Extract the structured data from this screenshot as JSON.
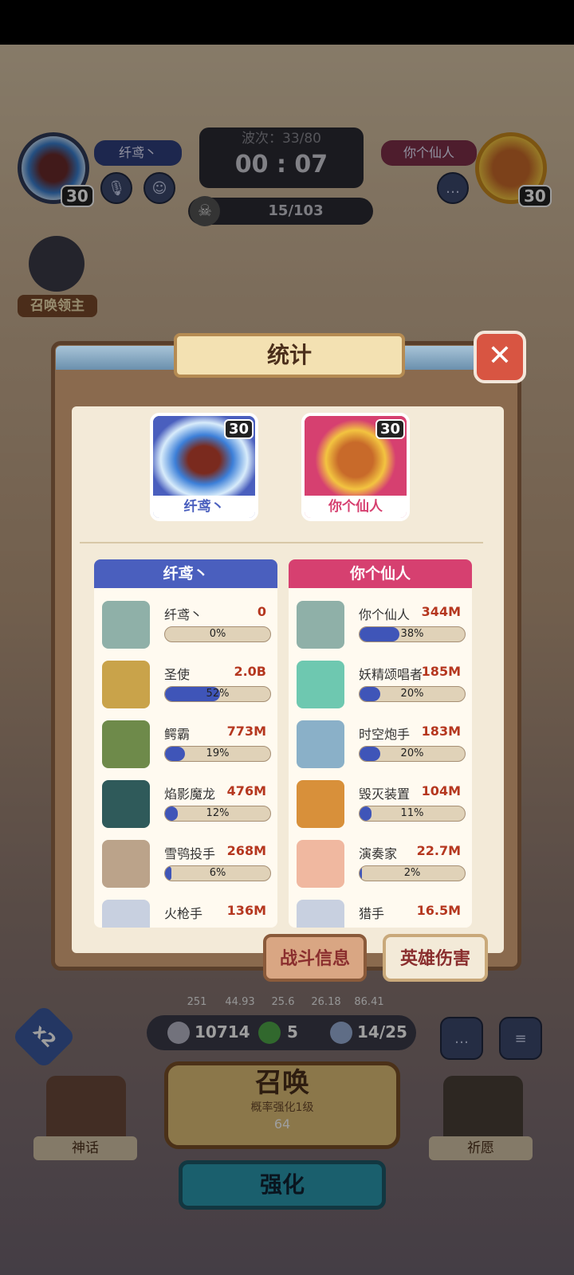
{
  "hud": {
    "left_player_name": "纤鸢丶",
    "left_level": "30",
    "right_player_name": "你个仙人",
    "right_level": "30",
    "wave_label": "波次：33/80",
    "timer": "00 : 07",
    "kill_counter": "15/103",
    "summon_lord_label": "召唤领主"
  },
  "modal": {
    "title": "统计",
    "close_icon": "close-icon",
    "player_cards": [
      {
        "name": "纤鸢丶",
        "level": "30",
        "color": "#4a5fbe"
      },
      {
        "name": "你个仙人",
        "level": "30",
        "color": "#d64070"
      }
    ],
    "left_column": {
      "header": "纤鸢丶",
      "color": "#4a5fbe",
      "rows": [
        {
          "name": "纤鸢丶",
          "value": "0",
          "percent": "0%",
          "fill": 0
        },
        {
          "name": "圣使",
          "value": "2.0B",
          "percent": "52%",
          "fill": 52
        },
        {
          "name": "鳄霸",
          "value": "773M",
          "percent": "19%",
          "fill": 19
        },
        {
          "name": "焰影魔龙",
          "value": "476M",
          "percent": "12%",
          "fill": 12
        },
        {
          "name": "雪鸮投手",
          "value": "268M",
          "percent": "6%",
          "fill": 6
        },
        {
          "name": "火枪手",
          "value": "136M",
          "percent": "",
          "fill": 3
        }
      ]
    },
    "right_column": {
      "header": "你个仙人",
      "color": "#d64070",
      "rows": [
        {
          "name": "你个仙人",
          "value": "344M",
          "percent": "38%",
          "fill": 38
        },
        {
          "name": "妖精颂唱者",
          "value": "185M",
          "percent": "20%",
          "fill": 20
        },
        {
          "name": "时空炮手",
          "value": "183M",
          "percent": "20%",
          "fill": 20
        },
        {
          "name": "毁灭装置",
          "value": "104M",
          "percent": "11%",
          "fill": 11
        },
        {
          "name": "演奏家",
          "value": "22.7M",
          "percent": "2%",
          "fill": 2
        },
        {
          "name": "猎手",
          "value": "16.5M",
          "percent": "",
          "fill": 2
        }
      ]
    },
    "tabs": {
      "battle_info": "战斗信息",
      "hero_damage": "英雄伤害"
    }
  },
  "bottom": {
    "stats": [
      "251",
      "44.93",
      "25.6",
      "26.18",
      "86.41"
    ],
    "coins": "10714",
    "clover": "5",
    "units": "14/25",
    "speed": "x2",
    "summon_title": "召唤",
    "summon_sub": "概率强化1级",
    "summon_cost": "64",
    "myth_label": "神话",
    "pray_label": "祈愿",
    "upgrade_label": "强化"
  }
}
